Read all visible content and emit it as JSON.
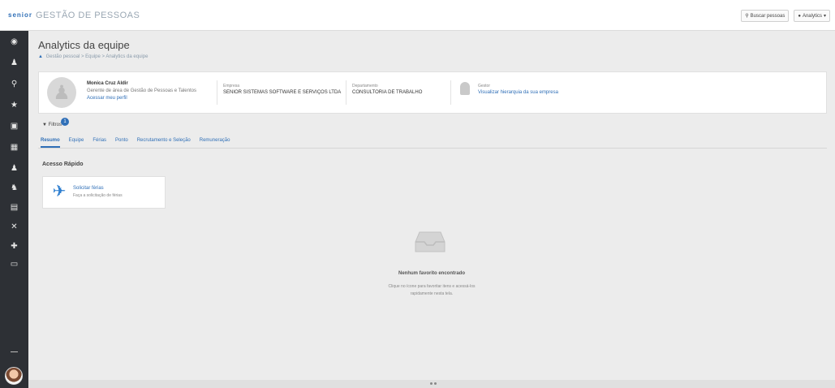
{
  "topbar": {
    "logo": "senior",
    "module_title": "GESTÃO DE PESSOAS",
    "actions": [
      {
        "icon": "search-icon",
        "label": "Buscar pessoas"
      },
      {
        "icon": "user-icon",
        "label": "Analytics"
      }
    ]
  },
  "sidebar": {
    "icons": [
      "home-icon",
      "user-icon",
      "search-icon",
      "star-icon",
      "briefcase-icon",
      "building-icon",
      "people-icon",
      "org-icon",
      "chart-icon",
      "tools-icon",
      "plus-icon",
      "monitor-icon"
    ]
  },
  "page": {
    "title": "Analytics da equipe",
    "breadcrumb": [
      "Gestão pessoal",
      "Equipe",
      "Analytics da equipe"
    ]
  },
  "profile": {
    "name": "Monica Cruz Aldir",
    "role": "Gerente de área de Gestão de Pessoas e Talentos",
    "link": "Acessar meu perfil",
    "company_label": "Empresa",
    "company_value": "SENIOR SISTEMAS SOFTWARE E SERVIÇOS LTDA",
    "department_label": "Departamento",
    "department_value": "CONSULTORIA DE TRABALHO",
    "manager_label": "Gestor",
    "manager_link": "Visualizar hierarquia da sua empresa"
  },
  "filter": {
    "label": "Filtros",
    "badge": "1"
  },
  "tabs": [
    {
      "label": "Resumo",
      "active": true
    },
    {
      "label": "Equipe",
      "active": false
    },
    {
      "label": "Férias",
      "active": false
    },
    {
      "label": "Ponto",
      "active": false
    },
    {
      "label": "Recrutamento e Seleção",
      "active": false
    },
    {
      "label": "Remuneração",
      "active": false
    }
  ],
  "quick_access": {
    "title": "Acesso Rápido",
    "card_title": "Solicitar férias",
    "card_subtitle": "Faça a solicitação de férias"
  },
  "empty_state": {
    "title": "Nenhum favorito encontrado",
    "description_line1": "Clique no ícone para favoritar itens e acessá-los",
    "description_line2": "rapidamente nesta tela."
  },
  "colors": {
    "accent": "#2f6fb7",
    "sidebar": "#2d3035",
    "background": "#ececec"
  }
}
